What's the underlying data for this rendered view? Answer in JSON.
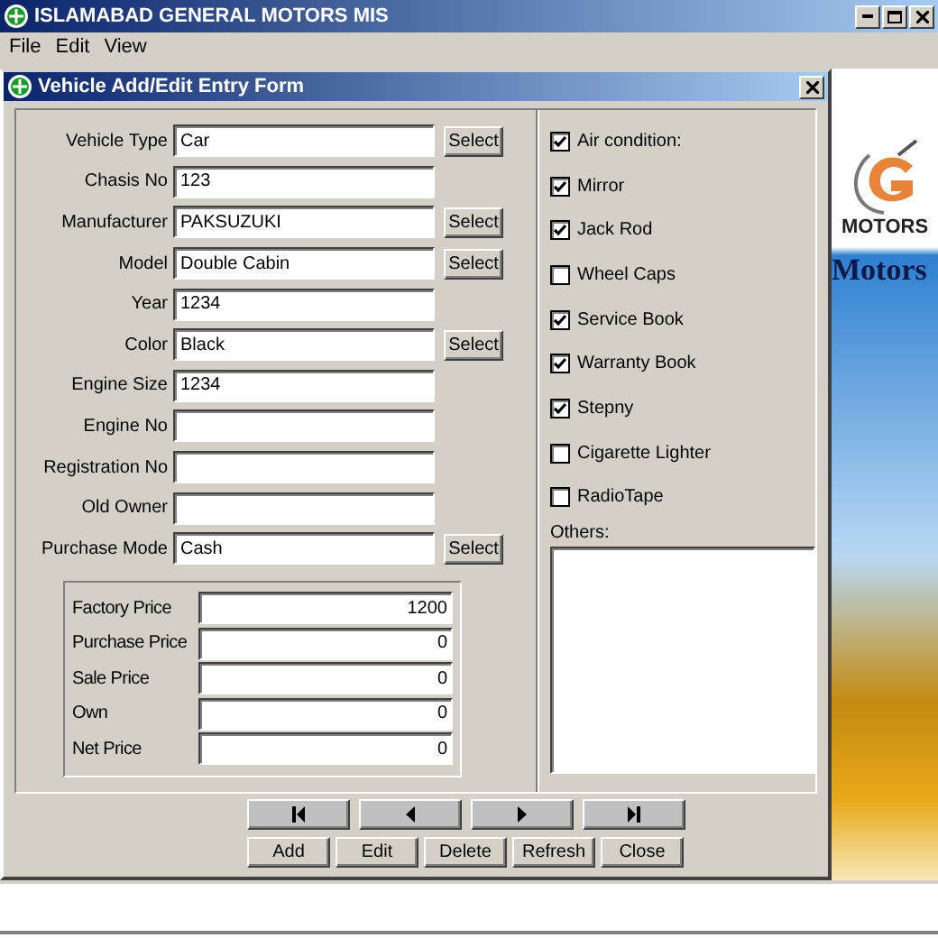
{
  "window": {
    "title": "ISLAMABAD GENERAL MOTORS MIS"
  },
  "menu": [
    "File",
    "Edit",
    "View"
  ],
  "form": {
    "title": "Vehicle Add/Edit Entry Form",
    "fields": [
      {
        "label": "Vehicle Type",
        "value": "Car",
        "button": "Select"
      },
      {
        "label": "Chasis No",
        "value": "123"
      },
      {
        "label": "Manufacturer",
        "value": "PAKSUZUKI",
        "button": "Select"
      },
      {
        "label": "Model",
        "value": "Double Cabin",
        "button": "Select"
      },
      {
        "label": "Year",
        "value": "1234"
      },
      {
        "label": "Color",
        "value": "Black",
        "button": "Select"
      },
      {
        "label": "Engine Size",
        "value": "1234"
      },
      {
        "label": "Engine No"
      },
      {
        "label": "Registration No"
      },
      {
        "label": "Old Owner"
      },
      {
        "label": "Purchase Mode",
        "value": "Cash",
        "button": "Select"
      }
    ],
    "prices": [
      {
        "label": "Factory Price",
        "value": "1200"
      },
      {
        "label": "Purchase Price",
        "value": "0"
      },
      {
        "label": "Sale Price",
        "value": "0"
      },
      {
        "label": "Own",
        "value": "0"
      },
      {
        "label": "Net Price",
        "value": "0"
      }
    ],
    "accessories": [
      {
        "label": "Air condition:",
        "checked": true
      },
      {
        "label": "Mirror",
        "checked": true
      },
      {
        "label": "Jack Rod",
        "checked": true
      },
      {
        "label": "Wheel Caps",
        "checked": false
      },
      {
        "label": "Service Book",
        "checked": true
      },
      {
        "label": "Warranty Book",
        "checked": true
      },
      {
        "label": "Stepny",
        "checked": true
      },
      {
        "label": "Cigarette Lighter",
        "checked": false
      },
      {
        "label": "RadioTape",
        "checked": false
      }
    ],
    "others": {
      "label": "Others:"
    },
    "navigation": [
      {
        "kind": "first"
      },
      {
        "kind": "previous"
      },
      {
        "kind": "next"
      },
      {
        "kind": "last"
      }
    ],
    "actions": [
      "Add",
      "Edit",
      "Delete",
      "Refresh",
      "Close"
    ]
  },
  "background": {
    "logo_text": "MOTORS",
    "caption": "Motors"
  }
}
